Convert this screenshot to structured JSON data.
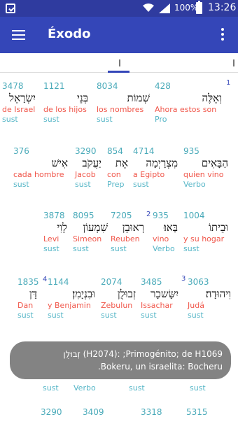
{
  "status": {
    "battery": "100%",
    "time": "13:26"
  },
  "appbar": {
    "title": "Éxodo"
  },
  "verses": {
    "v1": "1",
    "v2": "2",
    "v3": "3",
    "v4": "4"
  },
  "words": [
    {
      "num": "3478",
      "heb": "יִשְׂרָאֵל",
      "tr": "de Israel",
      "pos": "sust"
    },
    {
      "num": "1121",
      "heb": "בְּנֵי",
      "tr": "de los hijos",
      "pos": "sust"
    },
    {
      "num": "8034",
      "heb": "שְׁמוֹת",
      "tr": "los nombres",
      "pos": "sust"
    },
    {
      "num": "428",
      "heb": "וְאֵלֶּה",
      "tr": "Ahora estos son",
      "pos": "Pro"
    },
    {
      "num": "376",
      "heb": "אִישׁ",
      "tr": "cada hombre",
      "pos": "sust"
    },
    {
      "num": "3290",
      "heb": "יַעֲקֹב",
      "tr": "Jacob",
      "pos": "sust"
    },
    {
      "num": "854",
      "heb": "אֵת",
      "tr": "con",
      "pos": "Prep"
    },
    {
      "num": "4714",
      "heb": "מִצְרָיְמָה",
      "tr": "a Egipto",
      "pos": "sust"
    },
    {
      "num": "935",
      "heb": "הַבָּאִים",
      "tr": "quien vino",
      "pos": "Verbo"
    },
    {
      "num": "3878",
      "heb": "לֵוִי",
      "tr": "Levi",
      "pos": "sust"
    },
    {
      "num": "8095",
      "heb": "שִׁמְעוֹן",
      "tr": "Simeon",
      "pos": "sust"
    },
    {
      "num": "7205",
      "heb": "רְאוּבֵן",
      "tr": "Reuben",
      "pos": "sust"
    },
    {
      "num": "935",
      "heb": "בָּאוּ׃",
      "tr": "vino",
      "pos": "Verbo"
    },
    {
      "num": "1004",
      "heb": "וּבֵיתוֹ",
      "tr": "y su hogar",
      "pos": "sust"
    },
    {
      "num": "1835",
      "heb": "דָּן",
      "tr": "Dan",
      "pos": "sust"
    },
    {
      "num": "1144",
      "heb": "וּבִנְיָמִן׃",
      "tr": "y Benjamin",
      "pos": "sust"
    },
    {
      "num": "2074",
      "heb": "זְבוּלֻן",
      "tr": "Zebulun",
      "pos": "sust"
    },
    {
      "num": "3485",
      "heb": "יִשָּׂשכָר",
      "tr": "Issachar",
      "pos": "sust"
    },
    {
      "num": "3063",
      "heb": "וִיהוּדָה׃",
      "tr": "Judá",
      "pos": "sust"
    }
  ],
  "lower": {
    "pos1": "sust",
    "pos2": "Verbo",
    "pos3": "sust",
    "pos4": "sust",
    "num1": "3290",
    "num2": "3409",
    "num3": "3318",
    "num4": "5315"
  },
  "overlay": {
    "line1": "זְבוּלֻן (H2074): ;Primogénito; de H1069",
    "line2": ".Bokeru, un israelita: Bocheru"
  }
}
